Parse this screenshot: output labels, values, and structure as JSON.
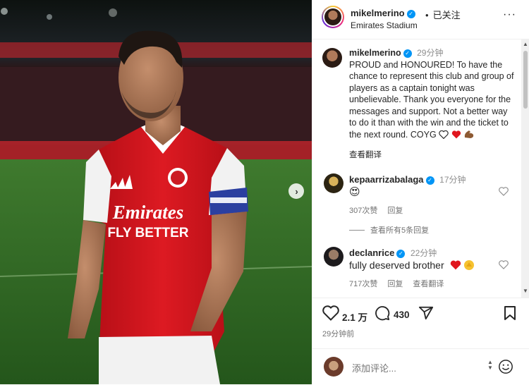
{
  "header": {
    "username": "mikelmerino",
    "follow_status": "已关注",
    "location": "Emirates Stadium",
    "more": "···"
  },
  "media": {
    "shirt_sponsor_line1": "Emirates",
    "shirt_sponsor_line2": "FLY BETTER",
    "next_icon": "chevron-right-icon"
  },
  "caption": {
    "username": "mikelmerino",
    "time": "29分钟",
    "text": "PROUD and HONOURED! To have the chance to represent this club and group of players as a captain tonight was unbelievable. Thank you everyone for the messages and support. Not a better way to do it than with the win and the ticket to the next round. COYG",
    "emojis": [
      "white-heart",
      "red-heart",
      "flexed-biceps"
    ],
    "see_translation": "查看翻译"
  },
  "comments": [
    {
      "username": "kepaarrizabalaga",
      "time": "17分钟",
      "text": "😍",
      "likes": "307次赞",
      "reply": "回复",
      "view_replies": "查看所有5条回复"
    },
    {
      "username": "declanrice",
      "time": "22分钟",
      "text": "fully deserved brother",
      "likes": "717次赞",
      "reply": "回复",
      "see_translation": "查看翻译"
    }
  ],
  "actions": {
    "like_count": "2.1 万",
    "comment_count": "430",
    "posted": "29分钟前"
  },
  "add_comment": {
    "placeholder": "添加评论..."
  },
  "colors": {
    "verified": "#0095f6",
    "arsenal_red": "#d8111a",
    "text": "#262626",
    "muted": "#737373"
  }
}
